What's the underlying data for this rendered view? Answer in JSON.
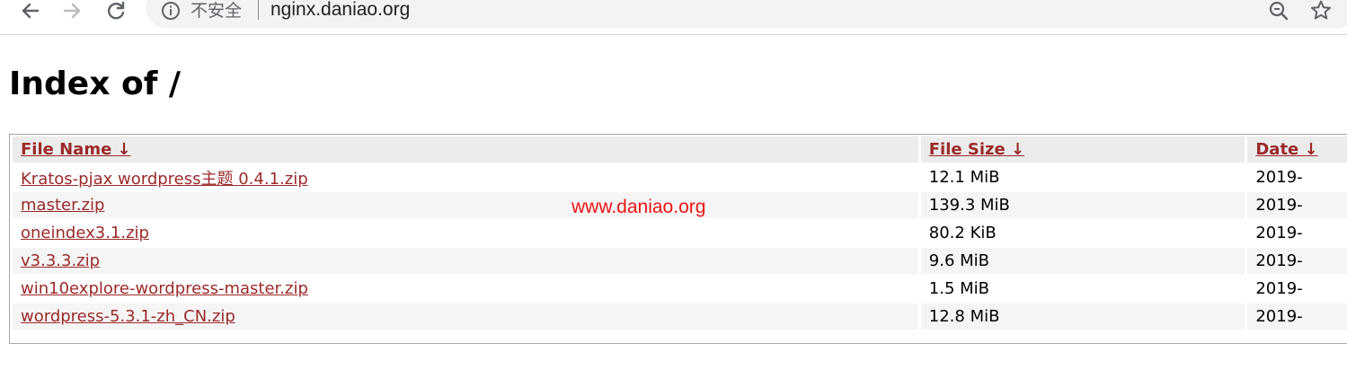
{
  "browser": {
    "security_label": "不安全",
    "url": "nginx.daniao.org",
    "icons": [
      "back-arrow-icon",
      "forward-arrow-icon",
      "reload-icon",
      "info-icon",
      "zoom-icon",
      "star-icon"
    ]
  },
  "page": {
    "title": "Index of /",
    "link_color": "#9b2a2a",
    "table": {
      "columns": [
        "File Name  ↓",
        "File Size  ↓",
        "Date  ↓"
      ],
      "rows": [
        {
          "name": "Kratos-pjax wordpress主题 0.4.1.zip",
          "size": "12.1 MiB",
          "date": "2019-"
        },
        {
          "name": "master.zip",
          "size": "139.3 MiB",
          "date": "2019-"
        },
        {
          "name": "oneindex3.1.zip",
          "size": "80.2 KiB",
          "date": "2019-"
        },
        {
          "name": "v3.3.3.zip",
          "size": "9.6 MiB",
          "date": "2019-"
        },
        {
          "name": "win10explore-wordpress-master.zip",
          "size": "1.5 MiB",
          "date": "2019-"
        },
        {
          "name": "wordpress-5.3.1-zh_CN.zip",
          "size": "12.8 MiB",
          "date": "2019-"
        }
      ]
    },
    "watermark": "www.daniao.org",
    "watermark_color": "#f01313"
  }
}
